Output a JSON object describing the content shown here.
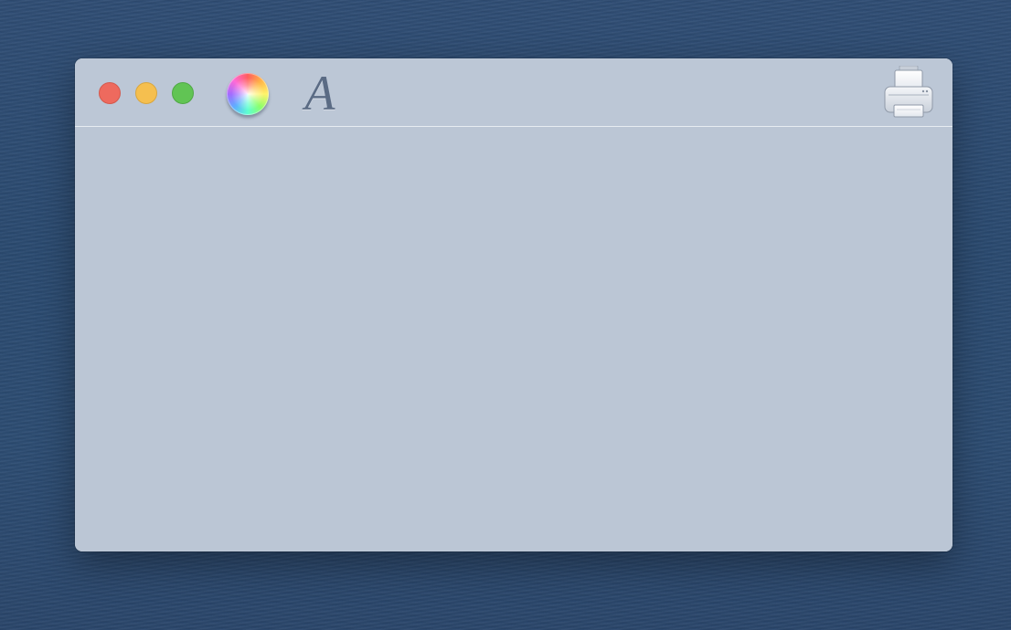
{
  "window": {
    "background_color": "#bbc6d5",
    "title": ""
  },
  "titlebar": {
    "buttons": [
      {
        "name": "close",
        "color": "#ee6a5e"
      },
      {
        "name": "minimize",
        "color": "#f5bf4f"
      },
      {
        "name": "zoom",
        "color": "#61c454"
      }
    ]
  },
  "toolbar": {
    "items": [
      {
        "icon": "color-wheel-icon"
      },
      {
        "icon": "font-icon",
        "glyph": "A"
      },
      {
        "icon": "printer-icon"
      }
    ]
  },
  "desktop": {
    "background_color": "#2c4a70"
  }
}
